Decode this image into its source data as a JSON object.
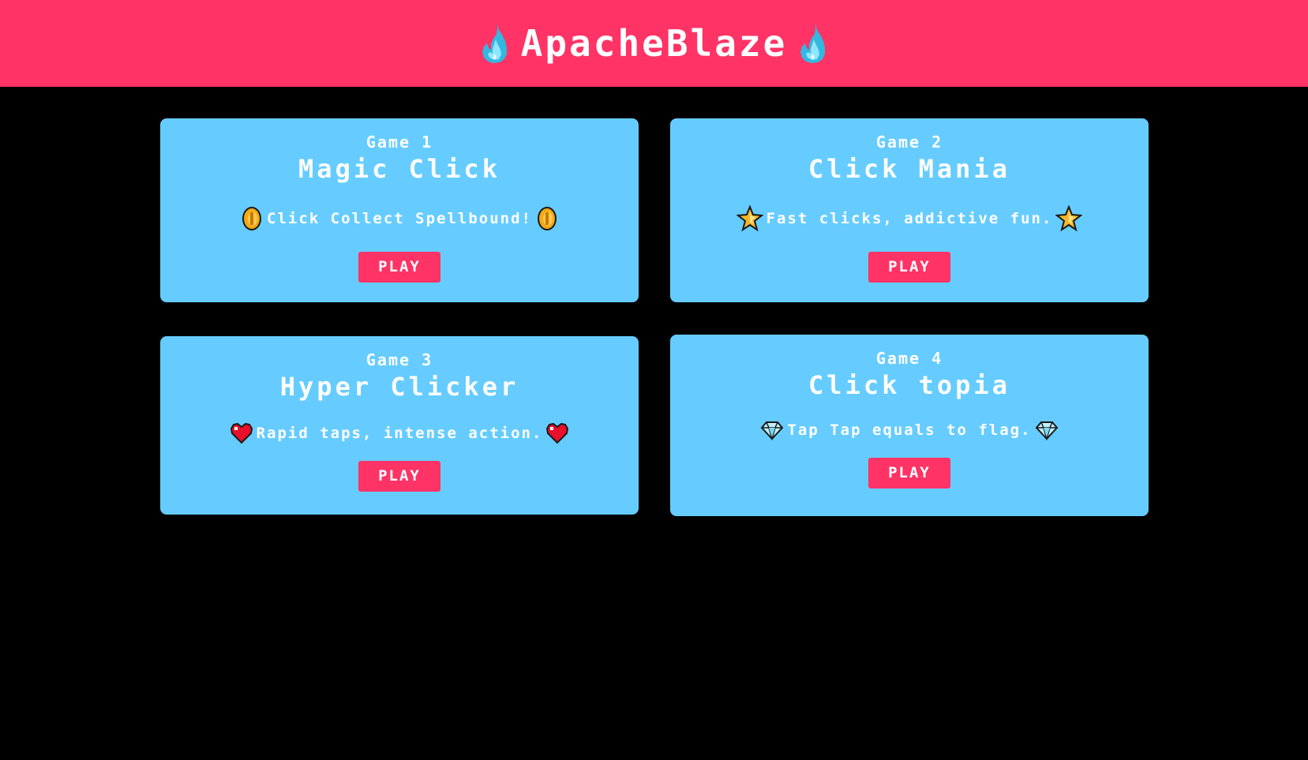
{
  "header": {
    "title": "ApacheBlaze",
    "icon": "blue-flame-icon",
    "color": "#ff3366"
  },
  "colors": {
    "background": "#000000",
    "card": "#66ccff",
    "accent": "#ff3366",
    "text": "#ffffff"
  },
  "games": [
    {
      "number": "Game 1",
      "name": "Magic Click",
      "description": "Click Collect Spellbound!",
      "icon": "coin-icon",
      "button": "PLAY"
    },
    {
      "number": "Game 2",
      "name": "Click Mania",
      "description": "Fast clicks, addictive fun.",
      "icon": "star-icon",
      "button": "PLAY"
    },
    {
      "number": "Game 3",
      "name": "Hyper Clicker",
      "description": "Rapid taps, intense action.",
      "icon": "heart-icon",
      "button": "PLAY"
    },
    {
      "number": "Game 4",
      "name": "Click topia",
      "description": "Tap Tap equals to flag.",
      "icon": "diamond-icon",
      "button": "PLAY"
    }
  ]
}
